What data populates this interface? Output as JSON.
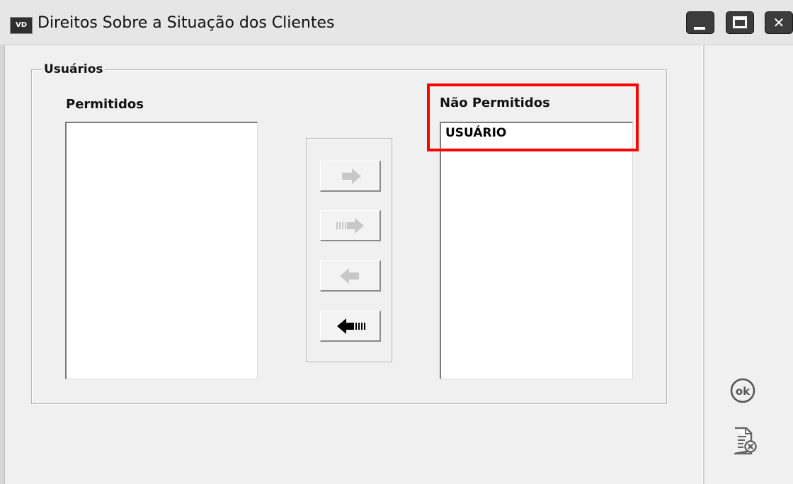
{
  "window": {
    "app_icon_text": "VD",
    "title": "Direitos Sobre a Situação dos Clientes"
  },
  "group": {
    "label": "Usuários"
  },
  "permitidos": {
    "label": "Permitidos",
    "items": []
  },
  "nao_permitidos": {
    "label": "Não Permitidos",
    "items": [
      "USUÁRIO"
    ]
  },
  "arrow_buttons": [
    {
      "name": "move-selected-right",
      "icon": "arrow-right-icon",
      "enabled": false
    },
    {
      "name": "move-all-right",
      "icon": "double-arrow-right-icon",
      "enabled": false
    },
    {
      "name": "move-selected-left",
      "icon": "arrow-left-icon",
      "enabled": false
    },
    {
      "name": "move-all-left",
      "icon": "double-arrow-left-icon",
      "enabled": true
    }
  ],
  "side_buttons": [
    {
      "name": "ok-button",
      "icon": "ok-icon",
      "text": "ok"
    },
    {
      "name": "cancel-button",
      "icon": "document-cancel-icon"
    }
  ],
  "colors": {
    "highlight": "#ff0000",
    "disabled_arrow": "#c8c8c8",
    "enabled_arrow": "#000000"
  }
}
